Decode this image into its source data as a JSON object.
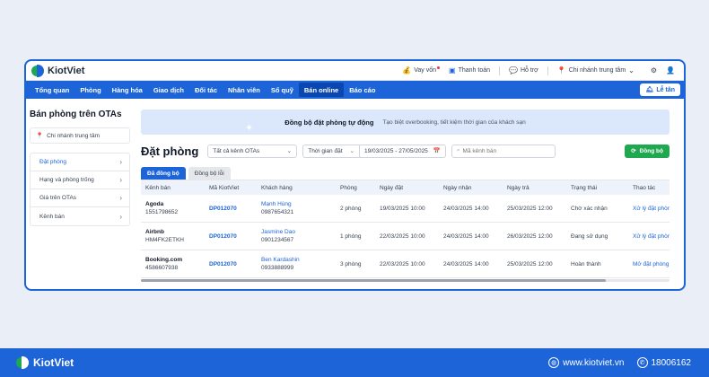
{
  "app": {
    "name": "KiotViet"
  },
  "topbar": {
    "loan": "Vay vốn",
    "payment": "Thanh toán",
    "support": "Hỗ trợ",
    "branch": "Chi nhánh trung tâm"
  },
  "nav": {
    "items": [
      "Tổng quan",
      "Phòng",
      "Hàng hóa",
      "Giao dịch",
      "Đối tác",
      "Nhân viên",
      "Sổ quỹ",
      "Bán online",
      "Báo cáo"
    ],
    "active_index": 7,
    "reception": "Lễ tân"
  },
  "sidebar": {
    "title": "Bán phòng trên OTAs",
    "branch": "Chi nhánh trung tâm",
    "items": [
      "Đặt phòng",
      "Hạng và phòng trống",
      "Giá trên OTAs",
      "Kênh bán"
    ]
  },
  "banner": {
    "title": "Đồng bộ đặt phòng tự động",
    "subtitle": "Tạo biệt overbooking, tiết kiệm thời gian của khách sạn"
  },
  "toolbar": {
    "page_title": "Đặt phòng",
    "channel_filter": "Tất cả kênh OTAs",
    "time_filter": "Thời gian đặt",
    "date_range": "19/03/2025 - 27/05/2025",
    "search_placeholder": "Mã kênh bán",
    "sync_button": "Đồng bộ"
  },
  "tabs": [
    "Đã đồng bộ",
    "Đồng bộ lỗi"
  ],
  "table": {
    "headers": [
      "Kênh bán",
      "Mã KiotViet",
      "Khách hàng",
      "Phòng",
      "Ngày đặt",
      "Ngày nhận",
      "Ngày trả",
      "Trạng thái",
      "Thao tác"
    ],
    "rows": [
      {
        "channel": "Agoda",
        "channel_code": "1551798652",
        "kv_code": "DP012070",
        "customer": "Mạnh Hùng",
        "phone": "0987654321",
        "rooms": "2 phòng",
        "booked": "19/03/2025 10:00",
        "checkin": "24/03/2025 14:00",
        "checkout": "25/03/2025 12:00",
        "status": "Chờ xác nhận",
        "action": "Xử lý đặt phòng"
      },
      {
        "channel": "Airbnb",
        "channel_code": "HM4FK2ETKH",
        "kv_code": "DP012070",
        "customer": "Jasmine Dao",
        "phone": "0901234567",
        "rooms": "1 phòng",
        "booked": "22/03/2025 10:00",
        "checkin": "24/03/2025 14:00",
        "checkout": "26/03/2025 12:00",
        "status": "Đang sử dụng",
        "action": "Xử lý đặt phòng"
      },
      {
        "channel": "Booking.com",
        "channel_code": "4586607938",
        "kv_code": "DP012070",
        "customer": "Ben Kardashin",
        "phone": "0933888999",
        "rooms": "3 phòng",
        "booked": "22/03/2025 10:00",
        "checkin": "24/03/2025 14:00",
        "checkout": "25/03/2025 12:00",
        "status": "Hoàn thành",
        "action": "Mở đặt phòng"
      }
    ]
  },
  "footer": {
    "brand": "KiotViet",
    "website": "www.kiotviet.vn",
    "hotline": "18006162"
  },
  "colors": {
    "primary": "#1c64d8",
    "success": "#1fa84f",
    "banner": "#dbe8fb"
  }
}
